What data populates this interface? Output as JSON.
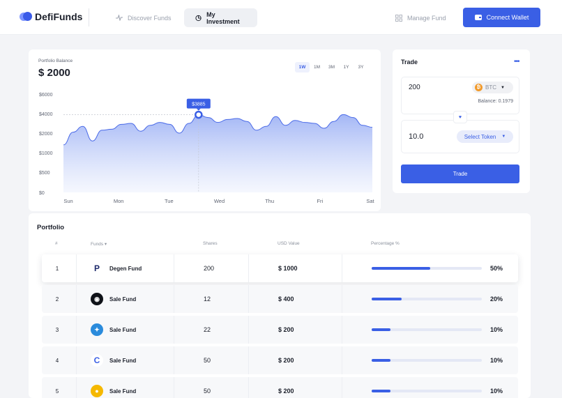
{
  "header": {
    "logo": "DefiFunds",
    "nav": [
      {
        "label": "Discover Funds",
        "icon": "activity-icon"
      },
      {
        "label": "My Investment",
        "icon": "pie-chart-icon"
      },
      {
        "label": "Manage Fund",
        "icon": "grid-icon"
      }
    ],
    "connect_label": "Connect Wallet"
  },
  "balance": {
    "label": "Portfolio Balance",
    "value": "$ 2000"
  },
  "ranges": [
    "1W",
    "1M",
    "3M",
    "1Y",
    "3Y"
  ],
  "active_range": "1W",
  "chart_data": {
    "type": "area",
    "x": [
      "Sun",
      "Mon",
      "Tue",
      "Wed",
      "Thu",
      "Fri",
      "Sat"
    ],
    "y_ticks": [
      "$6000",
      "$4000",
      "$2000",
      "$1000",
      "$500",
      "$0"
    ],
    "tooltip": {
      "label": "$3885",
      "x": "Tue",
      "value": 3885
    },
    "series": [
      {
        "points": [
          [
            "Sun",
            1400
          ],
          [
            "Sun",
            2100
          ],
          [
            "Sun",
            2700
          ],
          [
            "Sun",
            1600
          ],
          [
            "Sun",
            2300
          ],
          [
            "Sun",
            2400
          ],
          [
            "Mon",
            2900
          ],
          [
            "Mon",
            3000
          ],
          [
            "Mon",
            2200
          ],
          [
            "Mon",
            2800
          ],
          [
            "Mon",
            3100
          ],
          [
            "Mon",
            2900
          ],
          [
            "Tue",
            2000
          ],
          [
            "Tue",
            3000
          ],
          [
            "Tue",
            3885
          ],
          [
            "Tue",
            3600
          ],
          [
            "Tue",
            3100
          ],
          [
            "Wed",
            3400
          ],
          [
            "Wed",
            3500
          ],
          [
            "Wed",
            3200
          ],
          [
            "Wed",
            2300
          ],
          [
            "Wed",
            2700
          ],
          [
            "Thu",
            3700
          ],
          [
            "Thu",
            2800
          ],
          [
            "Thu",
            3300
          ],
          [
            "Thu",
            3100
          ],
          [
            "Thu",
            3000
          ],
          [
            "Fri",
            2500
          ],
          [
            "Fri",
            3200
          ],
          [
            "Fri",
            3900
          ],
          [
            "Fri",
            3600
          ],
          [
            "Sat",
            2800
          ],
          [
            "Sat",
            2600
          ]
        ]
      }
    ],
    "color": "#3a5fe5"
  },
  "trade": {
    "title": "Trade",
    "from_amount": "200",
    "from_token": "BTC",
    "balance": "Balance: 0.1979",
    "to_amount": "10.0",
    "select_label": "Select Token",
    "button": "Trade"
  },
  "portfolio": {
    "title": "Portfolio",
    "headers": {
      "num": "#",
      "funds": "Funds ▾",
      "shares": "Shares",
      "usd": "USD Value",
      "pct": "Percentage %"
    },
    "rows": [
      {
        "num": "1",
        "fund": "Degen Fund",
        "shares": "200",
        "usd": "$  1000",
        "pct": "50%",
        "pct_value": 0.53,
        "icon": "p-logo-icon",
        "icon_color": "#ffffff",
        "glyph": "P"
      },
      {
        "num": "2",
        "fund": "Sale Fund",
        "shares": "12",
        "usd": "$ 400",
        "pct": "20%",
        "pct_value": 0.27,
        "icon": "dark-token-icon",
        "icon_color": "#0f1218",
        "glyph": "◉"
      },
      {
        "num": "3",
        "fund": "Sale Fund",
        "shares": "22",
        "usd": "$ 200",
        "pct": "10%",
        "pct_value": 0.17,
        "icon": "blue-token-icon",
        "icon_color": "#2a8bdc",
        "glyph": "✦"
      },
      {
        "num": "4",
        "fund": "Sale Fund",
        "shares": "50",
        "usd": "$ 200",
        "pct": "10%",
        "pct_value": 0.17,
        "icon": "c-logo-icon",
        "icon_color": "#ffffff",
        "glyph": "C"
      },
      {
        "num": "5",
        "fund": "Sale Fund",
        "shares": "50",
        "usd": "$ 200",
        "pct": "10%",
        "pct_value": 0.17,
        "icon": "yellow-token-icon",
        "icon_color": "#f5b800",
        "glyph": "●"
      }
    ]
  }
}
